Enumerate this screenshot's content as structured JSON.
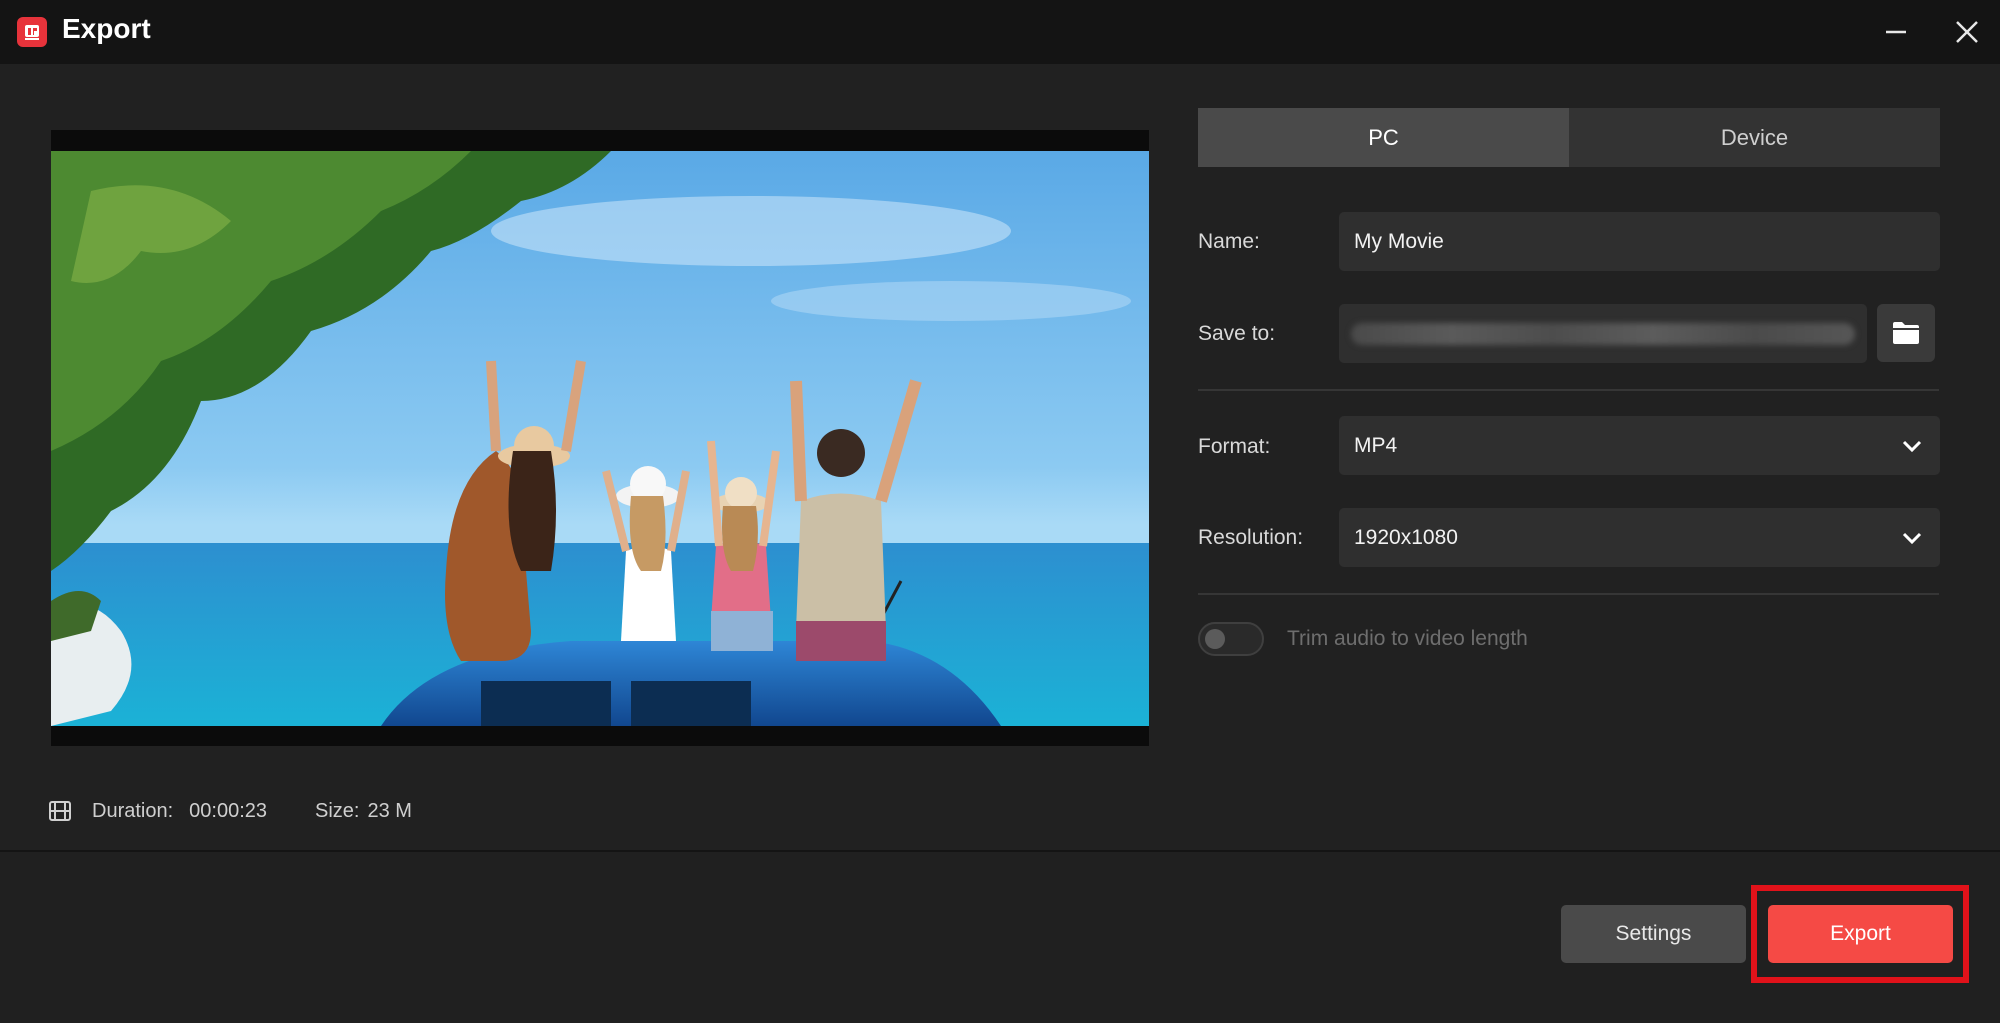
{
  "window": {
    "title": "Export",
    "app_icon": "app-logo-icon",
    "controls": {
      "minimize_icon": "minimize-icon",
      "close_icon": "close-icon"
    }
  },
  "preview": {
    "image": "family-beach-car-photo",
    "duration_label": "Duration:",
    "duration_value": "00:00:23",
    "size_label": "Size:",
    "size_value": "23 M",
    "film_icon": "film-icon"
  },
  "tabs": [
    {
      "label": "PC",
      "active": true
    },
    {
      "label": "Device",
      "active": false
    }
  ],
  "form": {
    "name_label": "Name:",
    "name_value": "My Movie",
    "save_to_label": "Save to:",
    "save_to_value": "",
    "folder_icon": "folder-icon",
    "format_label": "Format:",
    "format_value": "MP4",
    "resolution_label": "Resolution:",
    "resolution_value": "1920x1080",
    "trim_label": "Trim audio to video length",
    "trim_enabled": false
  },
  "buttons": {
    "settings": "Settings",
    "export": "Export"
  },
  "colors": {
    "accent": "#f54a45",
    "highlight": "#e1121a",
    "background": "#212121",
    "titlebar": "#141414"
  }
}
